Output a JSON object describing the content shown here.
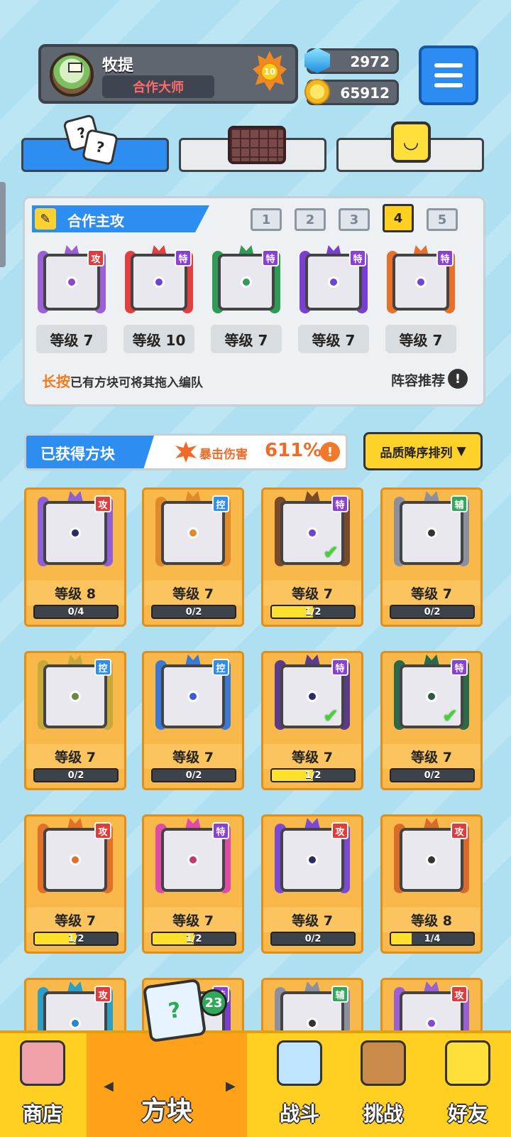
{
  "player": {
    "name": "牧提",
    "title": "合作大师",
    "level": "10"
  },
  "currency": {
    "gems": "2972",
    "coins": "65912"
  },
  "top_tabs": [
    {
      "icon": "dice-icon",
      "active": true
    },
    {
      "icon": "board-icon",
      "active": false
    },
    {
      "icon": "smile-block-icon",
      "active": false
    }
  ],
  "team_panel": {
    "title": "合作主攻",
    "slots": [
      "1",
      "2",
      "3",
      "4",
      "5"
    ],
    "active_slot": 4,
    "cards": [
      {
        "tag": "攻",
        "level": "等级 7",
        "color": "#9b5fd6",
        "dot": "#8a48d0"
      },
      {
        "tag": "特",
        "level": "等级 10",
        "color": "#e24040",
        "dot": "#6b44d8"
      },
      {
        "tag": "特",
        "level": "等级 7",
        "color": "#2f9c55",
        "dot": "#2f9c55"
      },
      {
        "tag": "特",
        "level": "等级 7",
        "color": "#7a3fd0",
        "dot": "#6b44d8"
      },
      {
        "tag": "特",
        "level": "等级 7",
        "color": "#e8702a",
        "dot": "#6b44d8"
      }
    ],
    "hint_emphasis": "长按",
    "hint_text": "已有方块可将其拖入编队",
    "recommend_label": "阵容推荐"
  },
  "acquired": {
    "title": "已获得方块",
    "crit_label": "暴击伤害",
    "crit_value": "611%",
    "sort_label": "品质降序排列"
  },
  "blocks": [
    {
      "tag": "攻",
      "tag_type": "atk",
      "level": "等级 8",
      "progress": "0/4",
      "fill": 0,
      "color": "#8f5fd6",
      "dot": "#2b2b6a",
      "check": false
    },
    {
      "tag": "控",
      "tag_type": "ctl",
      "level": "等级 7",
      "progress": "0/2",
      "fill": 0,
      "color": "#e08a2a",
      "dot": "#e08a2a",
      "check": false
    },
    {
      "tag": "特",
      "tag_type": "sp",
      "level": "等级 7",
      "progress": "1/2",
      "fill": 0.5,
      "color": "#7a4a2a",
      "dot": "#6b44d8",
      "check": true
    },
    {
      "tag": "辅",
      "tag_type": "sup",
      "level": "等级 7",
      "progress": "0/2",
      "fill": 0,
      "color": "#8c8f9e",
      "dot": "#333333",
      "check": false
    },
    {
      "tag": "控",
      "tag_type": "ctl",
      "level": "等级 7",
      "progress": "0/2",
      "fill": 0,
      "color": "#c9a83a",
      "dot": "#6b8a3a",
      "check": false
    },
    {
      "tag": "控",
      "tag_type": "ctl",
      "level": "等级 7",
      "progress": "0/2",
      "fill": 0,
      "color": "#3a7ad6",
      "dot": "#3a5ad6",
      "check": false
    },
    {
      "tag": "特",
      "tag_type": "sp",
      "level": "等级 7",
      "progress": "1/2",
      "fill": 0.5,
      "color": "#5a3a8a",
      "dot": "#2b2b6a",
      "check": true
    },
    {
      "tag": "特",
      "tag_type": "sp",
      "level": "等级 7",
      "progress": "0/2",
      "fill": 0,
      "color": "#2a6a4a",
      "dot": "#2b5a3a",
      "check": true
    },
    {
      "tag": "攻",
      "tag_type": "atk",
      "level": "等级 7",
      "progress": "1/2",
      "fill": 0.5,
      "color": "#e0702a",
      "dot": "#e0702a",
      "check": false
    },
    {
      "tag": "特",
      "tag_type": "sp",
      "level": "等级 7",
      "progress": "1/2",
      "fill": 0.5,
      "color": "#e04aa8",
      "dot": "#c23a6a",
      "check": false
    },
    {
      "tag": "攻",
      "tag_type": "atk",
      "level": "等级 7",
      "progress": "0/2",
      "fill": 0,
      "color": "#7a4ad6",
      "dot": "#2b2b6a",
      "check": false
    },
    {
      "tag": "攻",
      "tag_type": "atk",
      "level": "等级 8",
      "progress": "1/4",
      "fill": 0.25,
      "color": "#d86a2a",
      "dot": "#333333",
      "check": false
    },
    {
      "tag": "攻",
      "tag_type": "atk",
      "level": "",
      "progress": "",
      "fill": 0,
      "color": "#2aa0c8",
      "dot": "#2a8ac8",
      "check": false
    },
    {
      "tag": "特",
      "tag_type": "sp",
      "level": "",
      "progress": "",
      "fill": 0,
      "color": "#7a3fd0",
      "dot": "#6b44d8",
      "check": false
    },
    {
      "tag": "辅",
      "tag_type": "sup",
      "level": "",
      "progress": "",
      "fill": 0,
      "color": "#8c8f9e",
      "dot": "#333333",
      "check": false
    },
    {
      "tag": "攻",
      "tag_type": "atk",
      "level": "",
      "progress": "",
      "fill": 0,
      "color": "#9b5fd6",
      "dot": "#8a48d0",
      "check": false
    }
  ],
  "nav": {
    "items": [
      {
        "label": "商店",
        "icon": "shop-icon"
      },
      {
        "label": "方块",
        "icon": "cube-icon"
      },
      {
        "label": "战斗",
        "icon": "battle-icon"
      },
      {
        "label": "挑战",
        "icon": "challenge-icon"
      },
      {
        "label": "好友",
        "icon": "friends-icon"
      }
    ],
    "badge": "23"
  }
}
